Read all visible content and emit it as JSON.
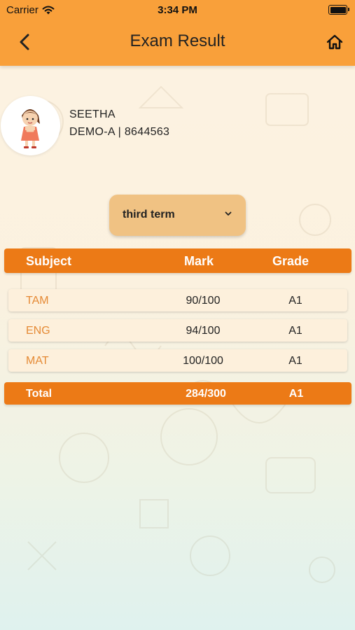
{
  "status_bar": {
    "carrier": "Carrier",
    "time": "3:34 PM"
  },
  "header": {
    "title": "Exam Result",
    "back_icon": "chevron-left-icon",
    "home_icon": "home-icon"
  },
  "student": {
    "name": "SEETHA",
    "class_info": "DEMO-A | 8644563"
  },
  "term_select": {
    "selected": "third term"
  },
  "table": {
    "headers": {
      "subject": "Subject",
      "mark": "Mark",
      "grade": "Grade"
    },
    "rows": [
      {
        "subject": "TAM",
        "mark": "90/100",
        "grade": "A1"
      },
      {
        "subject": "ENG",
        "mark": "94/100",
        "grade": "A1"
      },
      {
        "subject": "MAT",
        "mark": "100/100",
        "grade": "A1"
      }
    ],
    "total": {
      "label": "Total",
      "mark": "284/300",
      "grade": "A1"
    }
  },
  "colors": {
    "header": "#f9a03a",
    "accent": "#ec7a16",
    "subject_text": "#e58a35",
    "select_bg": "#f0c283"
  }
}
